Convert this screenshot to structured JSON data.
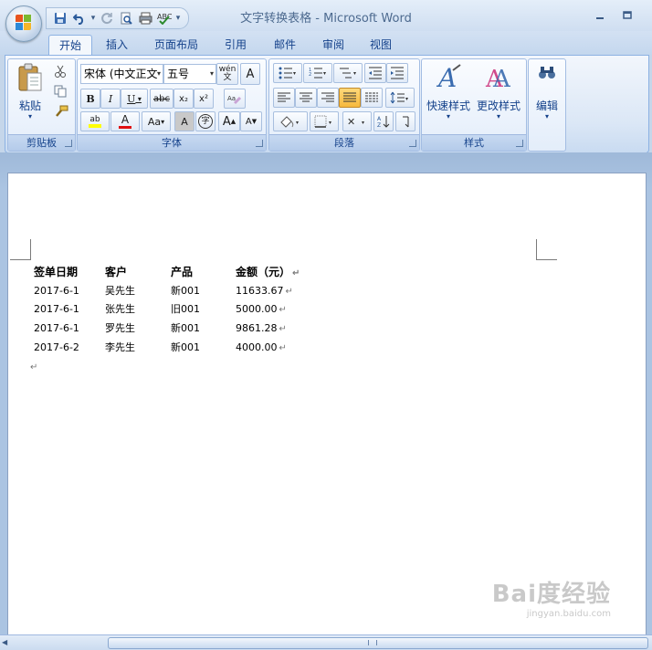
{
  "window": {
    "title": "文字转换表格 - Microsoft Word"
  },
  "tabs": [
    {
      "label": "开始",
      "active": true
    },
    {
      "label": "插入"
    },
    {
      "label": "页面布局"
    },
    {
      "label": "引用"
    },
    {
      "label": "邮件"
    },
    {
      "label": "审阅"
    },
    {
      "label": "视图"
    }
  ],
  "ribbon": {
    "clipboard": {
      "label": "剪贴板",
      "paste_label": "粘贴"
    },
    "font": {
      "label": "字体",
      "font_name": "宋体 (中文正文",
      "font_size": "五号",
      "phonetic_glyph": "wén",
      "bold": "B",
      "italic": "I",
      "underline": "U",
      "strike": "abc",
      "subscript": "x₂",
      "superscript": "x²",
      "text_effect_glyph": "A",
      "case_glyph": "Aa",
      "shading_glyph": "A",
      "enclose_glyph": "字",
      "grow_glyph": "A",
      "shrink_glyph": "A"
    },
    "paragraph": {
      "label": "段落"
    },
    "styles": {
      "label": "样式",
      "quick_styles": "快速样式",
      "change_styles": "更改样式"
    },
    "editing": {
      "label": "编辑"
    }
  },
  "document": {
    "headers": [
      "签单日期",
      "客户",
      "产品",
      "金额（元）"
    ],
    "rows": [
      [
        "2017-6-1",
        "吴先生",
        "新001",
        "11633.67"
      ],
      [
        "2017-6-1",
        "张先生",
        "旧001",
        "5000.00"
      ],
      [
        "2017-6-1",
        "罗先生",
        "新001",
        "9861.28"
      ],
      [
        "2017-6-2",
        "李先生",
        "新001",
        "4000.00"
      ]
    ],
    "paragraph_mark": "↵"
  },
  "watermark": {
    "text": "Bai度经验",
    "sub": "jingyan.baidu.com"
  },
  "colors": {
    "ribbon_text": "#15428b",
    "title_text": "#4d6a8f",
    "page_bg": "#ffffff",
    "workspace": "#abc4e2"
  }
}
